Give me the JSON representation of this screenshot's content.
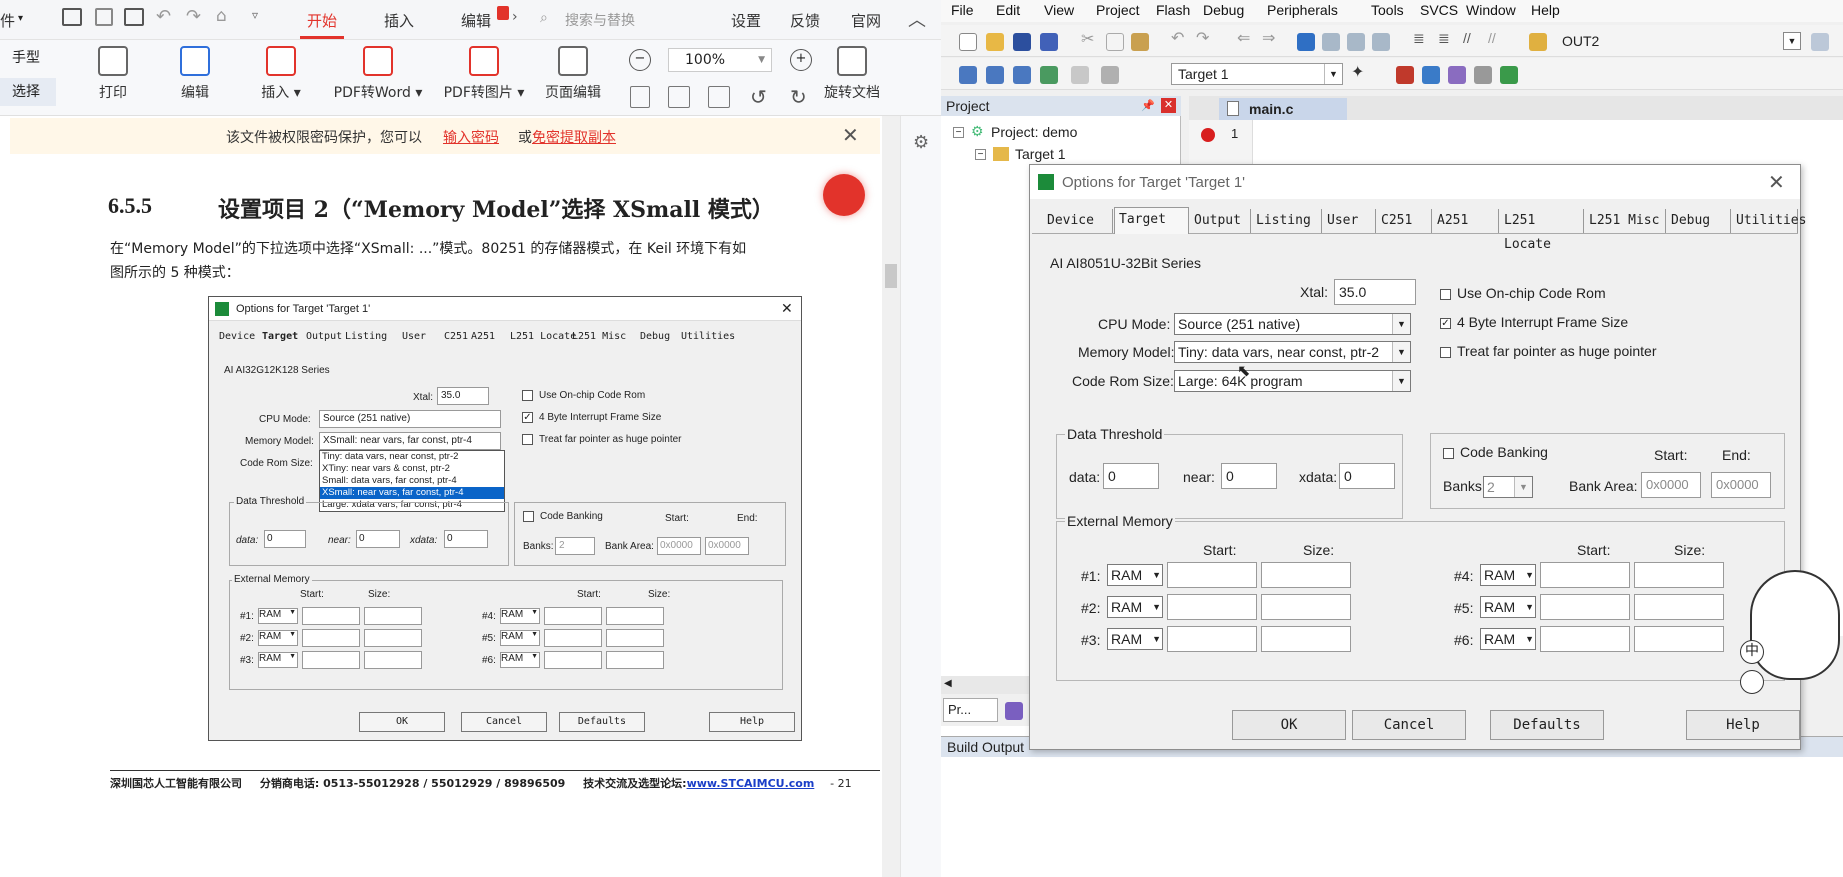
{
  "wps": {
    "tabs": {
      "file": "件",
      "home": "开始",
      "insert": "插入",
      "edit": "编辑",
      "search_placeholder": "搜索与替换",
      "settings": "设置",
      "feedback": "反馈",
      "website": "官网"
    },
    "side_tools": {
      "hand": "手型",
      "select": "选择"
    },
    "ribbon": {
      "print": "打印",
      "edit": "编辑",
      "insert": "插入",
      "pdf_to_word": "PDF转Word",
      "pdf_to_image": "PDF转图片",
      "page_edit": "页面编辑",
      "zoom": "100%",
      "rotate": "旋转文档"
    },
    "password_bar": {
      "text": "该文件被权限密码保护，您可以",
      "link1": "输入密码",
      "or": "或",
      "link2": "免密提取副本"
    }
  },
  "doc": {
    "section_no": "6.5.5",
    "section_title": "设置项目 2（“Memory Model”选择 XSmall 模式）",
    "para_line1": "在“Memory Model”的下拉选项中选择“XSmall: ...”模式。80251 的存储器模式，在 Keil 环境下有如",
    "para_line2": "图所示的 5 种模式：",
    "footer": {
      "company": "深圳国芯人工智能有限公司",
      "phone": "分销商电话: 0513-55012928 / 55012929 / 89896509",
      "forum_label": "技术交流及选型论坛:",
      "forum_url": "www.STCAIMCU.com",
      "page": "- 21"
    }
  },
  "pdf_dialog": {
    "title": "Options for Target 'Target 1'",
    "tabs": [
      "Device",
      "Target",
      "Output",
      "Listing",
      "User",
      "C251",
      "A251",
      "L251 Locate",
      "L251 Misc",
      "Debug",
      "Utilities"
    ],
    "series": "AI AI32G12K128 Series",
    "xtal_label": "Xtal:",
    "xtal": "35.0",
    "cpu_mode_label": "CPU Mode:",
    "cpu_mode": "Source (251 native)",
    "memory_model_label": "Memory Model:",
    "memory_model": "XSmall: near vars, far const, ptr-4",
    "code_rom_label": "Code Rom Size:",
    "memory_options": [
      "Tiny: data vars, near const, ptr-2",
      "XTiny: near vars & const, ptr-2",
      "Small: data vars, far const, ptr-4",
      "XSmall: near vars, far const, ptr-4",
      "Large: xdata vars, far const, ptr-4"
    ],
    "use_onchip": "Use On-chip Code Rom",
    "four_byte": "4 Byte Interrupt Frame Size",
    "treat_far": "Treat far pointer as huge pointer",
    "data_threshold": "Data Threshold",
    "data_label": "data:",
    "data": "0",
    "near_label": "near:",
    "near": "0",
    "xdata_label": "xdata:",
    "xdata": "0",
    "code_banking": "Code Banking",
    "banks_label": "Banks:",
    "banks": "2",
    "start": "Start:",
    "end": "End:",
    "bank_area": "Bank Area:",
    "bank_start": "0x0000",
    "bank_end": "0x0000",
    "external_memory": "External Memory",
    "size": "Size:",
    "ram_rows_left": [
      "#1:",
      "#2:",
      "#3:"
    ],
    "ram_rows_right": [
      "#4:",
      "#5:",
      "#6:"
    ],
    "ram": "RAM",
    "ok": "OK",
    "cancel": "Cancel",
    "defaults": "Defaults",
    "help": "Help"
  },
  "keil": {
    "menu": [
      "File",
      "Edit",
      "View",
      "Project",
      "Flash",
      "Debug",
      "Peripherals",
      "Tools",
      "SVCS",
      "Window",
      "Help"
    ],
    "toolbar_target_out": "OUT2",
    "target_select": "Target 1",
    "project_header": "Project",
    "project_root": "Project: demo",
    "project_target": "Target 1",
    "editor_tab": "main.c",
    "line_no": "1",
    "bottom_tab": "Pr...",
    "build_output": "Build Output"
  },
  "keil_dialog": {
    "title": "Options for Target 'Target 1'",
    "tabs": [
      "Device",
      "Target",
      "Output",
      "Listing",
      "User",
      "C251",
      "A251",
      "L251 Locate",
      "L251 Misc",
      "Debug",
      "Utilities"
    ],
    "series": "AI AI8051U-32Bit Series",
    "xtal_label": "Xtal:",
    "xtal": "35.0",
    "cpu_mode_label": "CPU Mode:",
    "cpu_mode": "Source (251 native)",
    "memory_model_label": "Memory Model:",
    "memory_model": "Tiny: data vars, near const, ptr-2",
    "code_rom_label": "Code Rom Size:",
    "code_rom": "Large: 64K program",
    "use_onchip": "Use On-chip Code Rom",
    "four_byte": "4 Byte Interrupt Frame Size",
    "treat_far": "Treat far pointer as huge pointer",
    "data_threshold": "Data Threshold",
    "data_label": "data:",
    "data": "0",
    "near_label": "near:",
    "near": "0",
    "xdata_label": "xdata:",
    "xdata": "0",
    "code_banking": "Code Banking",
    "banks_label": "Banks:",
    "banks": "2",
    "start": "Start:",
    "end": "End:",
    "bank_area": "Bank Area:",
    "bank_start": "0x0000",
    "bank_end": "0x0000",
    "external_memory": "External Memory",
    "size": "Size:",
    "ram_rows_left": [
      "#1:",
      "#2:",
      "#3:"
    ],
    "ram_rows_right": [
      "#4:",
      "#5:",
      "#6:"
    ],
    "ram": "RAM",
    "ok": "OK",
    "cancel": "Cancel",
    "defaults": "Defaults",
    "help": "Help"
  },
  "ime": {
    "lang": "中"
  },
  "colors": {
    "wps_accent": "#e2332b",
    "keil_highlight": "#0a64c8",
    "bp_red": "#d81e1e"
  }
}
